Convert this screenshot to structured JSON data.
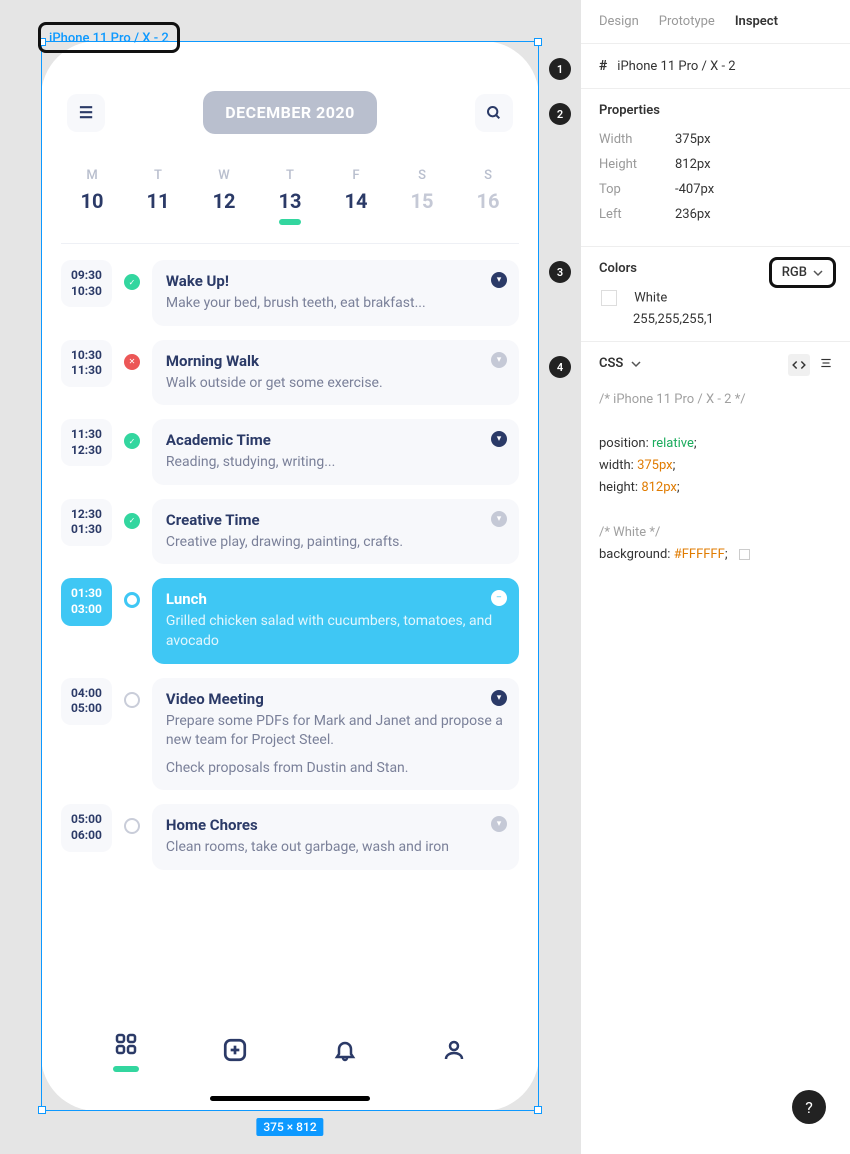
{
  "canvas": {
    "frame_label": "iPhone 11 Pro / X - 2",
    "dimensions_label": "375 × 812"
  },
  "phone": {
    "month_label": "DECEMBER 2020",
    "days": [
      {
        "letter": "M",
        "num": "10",
        "muted": false,
        "selected": false
      },
      {
        "letter": "T",
        "num": "11",
        "muted": false,
        "selected": false
      },
      {
        "letter": "W",
        "num": "12",
        "muted": false,
        "selected": false
      },
      {
        "letter": "T",
        "num": "13",
        "muted": false,
        "selected": true
      },
      {
        "letter": "F",
        "num": "14",
        "muted": false,
        "selected": false
      },
      {
        "letter": "S",
        "num": "15",
        "muted": true,
        "selected": false
      },
      {
        "letter": "S",
        "num": "16",
        "muted": true,
        "selected": false
      }
    ],
    "events": [
      {
        "t1": "09:30",
        "t2": "10:30",
        "status": "green",
        "title": "Wake Up!",
        "desc": "Make your bed, brush teeth, eat brakfast...",
        "caret": "blue",
        "active": false
      },
      {
        "t1": "10:30",
        "t2": "11:30",
        "status": "red",
        "title": "Morning Walk",
        "desc": "Walk outside or get some exercise.",
        "caret": "grey",
        "active": false
      },
      {
        "t1": "11:30",
        "t2": "12:30",
        "status": "green",
        "title": "Academic Time",
        "desc": "Reading, studying, writing...",
        "caret": "blue",
        "active": false
      },
      {
        "t1": "12:30",
        "t2": "01:30",
        "status": "green",
        "title": "Creative Time",
        "desc": "Creative play, drawing, painting, crafts.",
        "caret": "grey",
        "active": false
      },
      {
        "t1": "01:30",
        "t2": "03:00",
        "status": "cyan",
        "title": "Lunch",
        "desc": "Grilled chicken salad with cucumbers, tomatoes, and avocado",
        "caret": "white",
        "active": true
      },
      {
        "t1": "04:00",
        "t2": "05:00",
        "status": "grey",
        "title": "Video Meeting",
        "desc": "Prepare some PDFs for Mark and Janet and propose a new team for Project Steel.",
        "desc2": "Check proposals from Dustin and Stan.",
        "caret": "blue",
        "active": false
      },
      {
        "t1": "05:00",
        "t2": "06:00",
        "status": "grey",
        "title": "Home Chores",
        "desc": "Clean rooms, take out garbage, wash and iron",
        "caret": "grey",
        "active": false
      }
    ]
  },
  "panel": {
    "tabs": {
      "design": "Design",
      "prototype": "Prototype",
      "inspect": "Inspect"
    },
    "frame_name": "iPhone 11 Pro / X - 2",
    "properties_title": "Properties",
    "props": {
      "width_k": "Width",
      "width_v": "375px",
      "height_k": "Height",
      "height_v": "812px",
      "top_k": "Top",
      "top_v": "-407px",
      "left_k": "Left",
      "left_v": "236px"
    },
    "colors_title": "Colors",
    "color_mode": "RGB",
    "color_name": "White",
    "color_value": "255,255,255,1",
    "css_title": "CSS",
    "help": "?",
    "code": {
      "c1": "/* iPhone 11 Pro / X - 2 */",
      "l1a": "position: ",
      "l1b": "relative",
      "l1c": ";",
      "l2a": "width: ",
      "l2b": "375px",
      "l2c": ";",
      "l3a": "height: ",
      "l3b": "812px",
      "l3c": ";",
      "c2": "/* White */",
      "l4a": "background: ",
      "l4b": "#FFFFFF",
      "l4c": ";"
    }
  }
}
